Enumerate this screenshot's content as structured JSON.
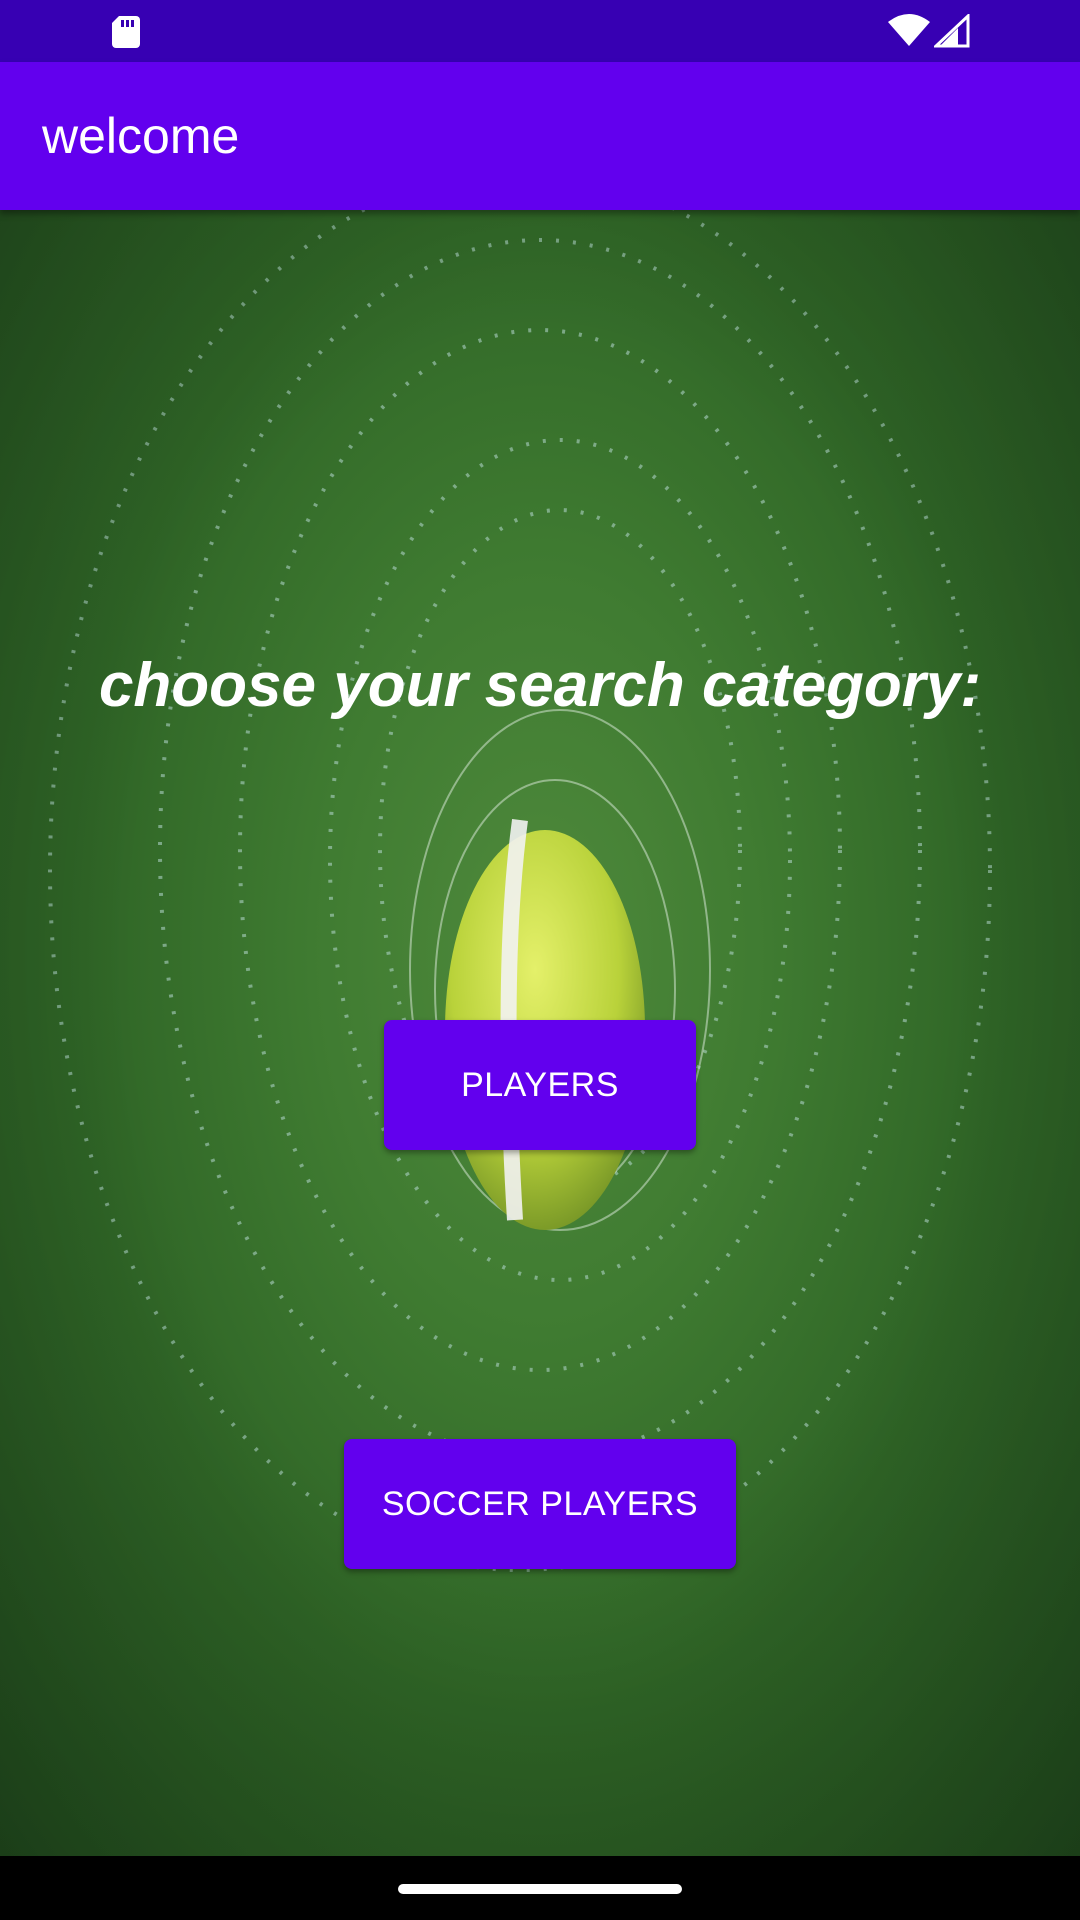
{
  "status_bar": {
    "background": "#3700b3",
    "icons": [
      "sd-card-icon",
      "wifi-icon",
      "cell-signal-icon"
    ]
  },
  "app_bar": {
    "title": "welcome",
    "background": "#6200ee"
  },
  "main": {
    "heading": "choose your search category:",
    "background_image": "tennis-ball-splash",
    "buttons": {
      "players_label": "PLAYERS",
      "soccer_players_label": "SOCCER PLAYERS"
    },
    "button_color": "#6200ee"
  },
  "nav_bar": {
    "background": "#000000",
    "indicator": "home-indicator"
  }
}
